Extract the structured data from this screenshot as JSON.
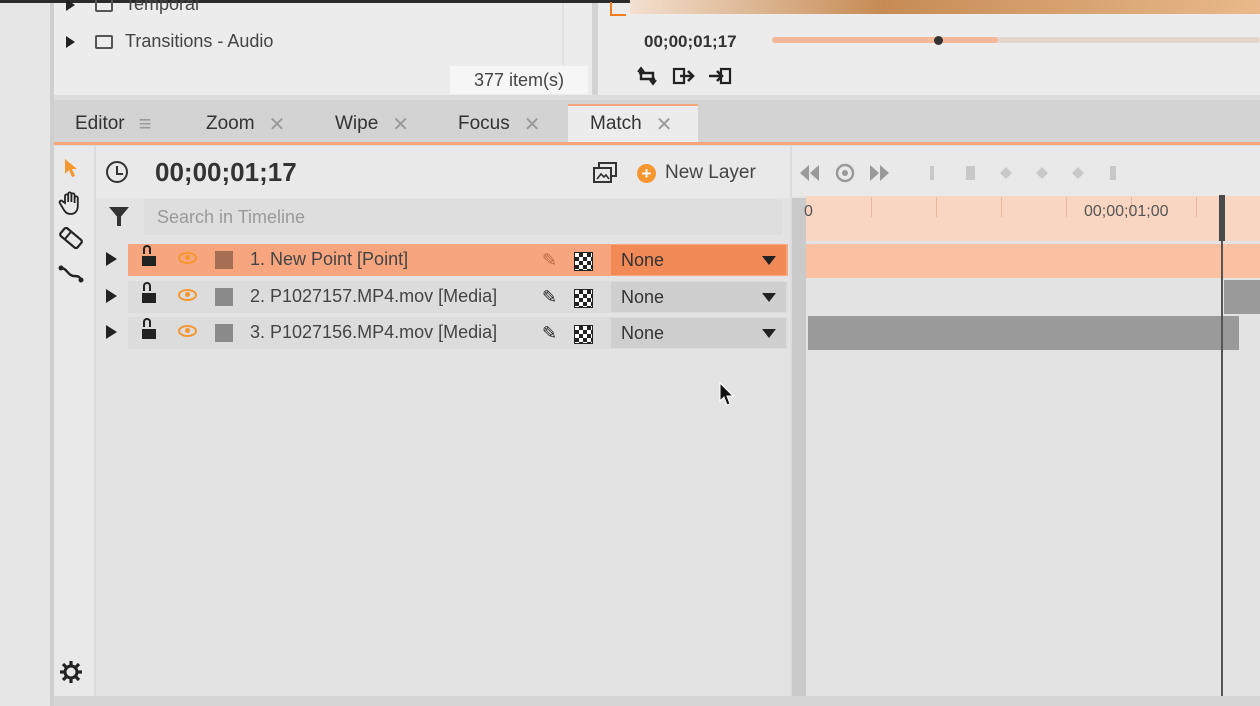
{
  "media_panel": {
    "items": [
      {
        "label": "Temporal"
      },
      {
        "label": "Transitions - Audio"
      }
    ],
    "item_count": "377 item(s)"
  },
  "preview": {
    "timecode": "00;00;01;17",
    "scrub_position": 0.34,
    "controls": [
      "loop-icon",
      "export-icon",
      "import-icon"
    ]
  },
  "tabs": [
    {
      "label": "Editor",
      "active": false,
      "icon": "menu-icon"
    },
    {
      "label": "Zoom",
      "active": false,
      "icon": "close-icon"
    },
    {
      "label": "Wipe",
      "active": false,
      "icon": "close-icon"
    },
    {
      "label": "Focus",
      "active": false,
      "icon": "close-icon"
    },
    {
      "label": "Match",
      "active": true,
      "icon": "close-icon"
    }
  ],
  "tools": [
    "pointer-icon",
    "hand-icon",
    "razor-icon",
    "curve-icon"
  ],
  "timeline": {
    "timecode": "00;00;01;17",
    "new_layer_label": "New Layer",
    "search_placeholder": "Search in Timeline",
    "ruler_labels": [
      "0",
      "00;00;01;00"
    ],
    "layers": [
      {
        "label": "1. New Point [Point]",
        "blend": "None",
        "selected": true
      },
      {
        "label": "2. P1027157.MP4.mov [Media]",
        "blend": "None",
        "selected": false
      },
      {
        "label": "3. P1027156.MP4.mov [Media]",
        "blend": "None",
        "selected": false
      }
    ]
  },
  "colors": {
    "accent": "#f5962f",
    "selection": "#f7a57e",
    "ruler": "#f8d6c1"
  }
}
